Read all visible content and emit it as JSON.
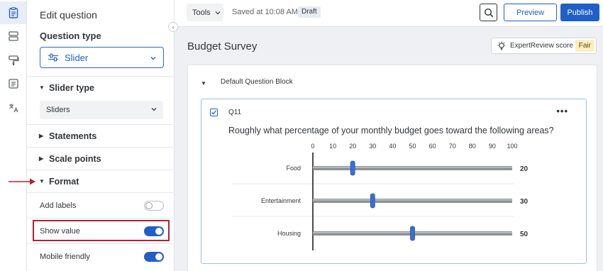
{
  "rail": {
    "items": [
      "survey-icon",
      "blocks-icon",
      "look-and-feel-icon",
      "survey-flow-icon",
      "translate-icon"
    ]
  },
  "panel": {
    "title": "Edit question",
    "question_type_label": "Question type",
    "question_type_value": "Slider",
    "sections": {
      "slider_type": "Slider type",
      "statements": "Statements",
      "scale_points": "Scale points",
      "format": "Format"
    },
    "slider_type_value": "Sliders",
    "format_options": [
      {
        "label": "Add labels",
        "on": false
      },
      {
        "label": "Show value",
        "on": true
      },
      {
        "label": "Mobile friendly",
        "on": true
      }
    ]
  },
  "toolbar": {
    "tools_label": "Tools",
    "saved_text": "Saved at 10:08 AM",
    "draft_badge": "Draft",
    "preview_label": "Preview",
    "publish_label": "Publish"
  },
  "survey": {
    "title": "Budget Survey",
    "expert_review_label": "ExpertReview score",
    "expert_review_rating": "Fair",
    "block_name": "Default Question Block"
  },
  "question": {
    "number": "Q11",
    "text": "Roughly what percentage of your monthly budget goes toward the following areas?",
    "scale_ticks": [
      "0",
      "10",
      "20",
      "30",
      "40",
      "50",
      "60",
      "70",
      "80",
      "90",
      "100"
    ],
    "scale_min": 0,
    "scale_max": 100,
    "statements": [
      {
        "label": "Food",
        "value": 20,
        "value_text": "20"
      },
      {
        "label": "Entertainment",
        "value": 30,
        "value_text": "30"
      },
      {
        "label": "Housing",
        "value": 50,
        "value_text": "50"
      }
    ]
  },
  "colors": {
    "accent": "#1f5fc7",
    "highlight": "#b22232",
    "fair_badge": "#fbedc4"
  }
}
